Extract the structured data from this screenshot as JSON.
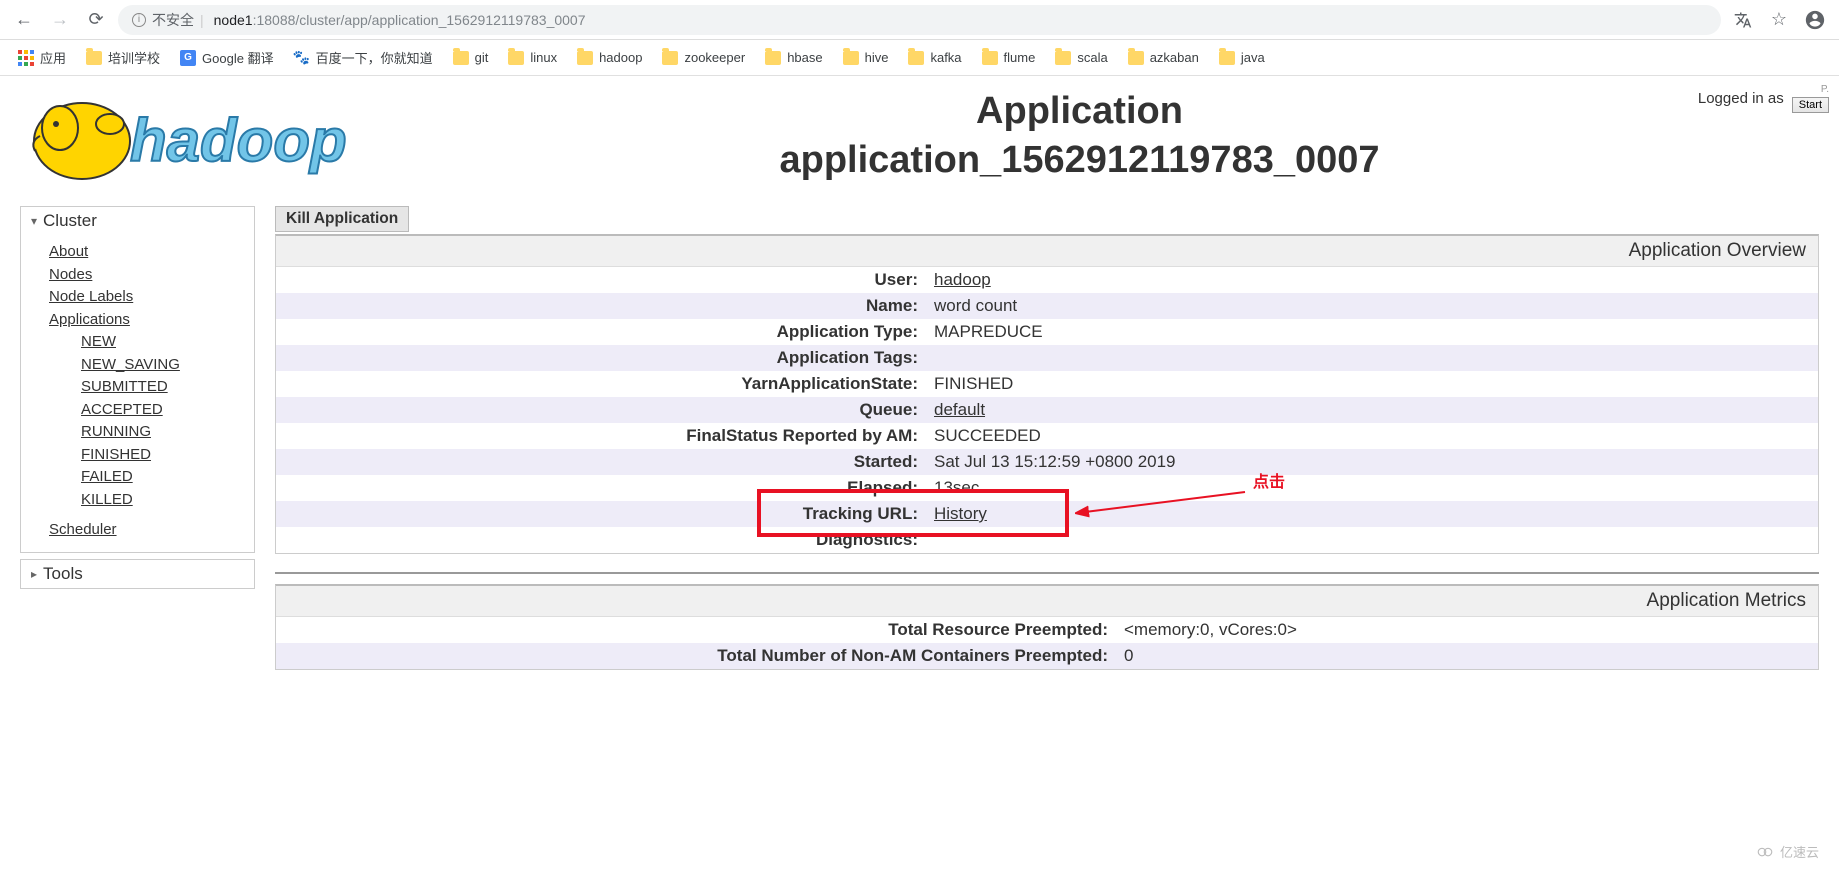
{
  "browser": {
    "insecure_label": "不安全",
    "url_host": "node1",
    "url_path": ":18088/cluster/app/application_1562912119783_0007"
  },
  "bookmarks": {
    "apps": "应用",
    "items": [
      "培训学校",
      "Google 翻译",
      "百度一下，你就知道",
      "git",
      "linux",
      "hadoop",
      "zookeeper",
      "hbase",
      "hive",
      "kafka",
      "flume",
      "scala",
      "azkaban",
      "java"
    ]
  },
  "logged_in": "Logged in as",
  "start_btn": "Start",
  "logo_text": "hadoop",
  "title_line1": "Application",
  "title_line2": "application_1562912119783_0007",
  "sidebar": {
    "cluster": "Cluster",
    "about": "About",
    "nodes": "Nodes",
    "node_labels": "Node Labels",
    "applications": "Applications",
    "states": [
      "NEW",
      "NEW_SAVING",
      "SUBMITTED",
      "ACCEPTED",
      "RUNNING",
      "FINISHED",
      "FAILED",
      "KILLED"
    ],
    "scheduler": "Scheduler",
    "tools": "Tools"
  },
  "kill_btn": "Kill Application",
  "overview_title": "Application Overview",
  "overview": {
    "rows": [
      {
        "label": "User:",
        "value": "hadoop",
        "link": true
      },
      {
        "label": "Name:",
        "value": "word count"
      },
      {
        "label": "Application Type:",
        "value": "MAPREDUCE"
      },
      {
        "label": "Application Tags:",
        "value": ""
      },
      {
        "label": "YarnApplicationState:",
        "value": "FINISHED"
      },
      {
        "label": "Queue:",
        "value": "default",
        "link": true
      },
      {
        "label": "FinalStatus Reported by AM:",
        "value": "SUCCEEDED"
      },
      {
        "label": "Started:",
        "value": "Sat Jul 13 15:12:59 +0800 2019"
      },
      {
        "label": "Elapsed:",
        "value": "13sec"
      },
      {
        "label": "Tracking URL:",
        "value": "History",
        "link": true
      },
      {
        "label": "Diagnostics:",
        "value": ""
      }
    ]
  },
  "annotation": "点击",
  "metrics_title": "Application Metrics",
  "metrics": {
    "rows": [
      {
        "label": "Total Resource Preempted:",
        "value": "<memory:0, vCores:0>"
      },
      {
        "label": "Total Number of Non-AM Containers Preempted:",
        "value": "0"
      }
    ]
  },
  "watermark": "亿速云"
}
